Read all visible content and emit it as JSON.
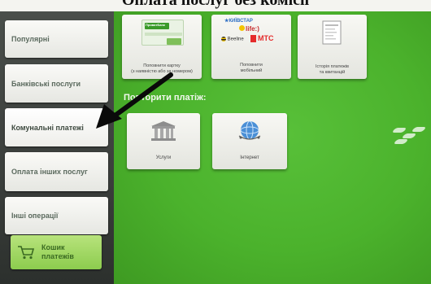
{
  "header": {
    "cropped_title": "Оплата послуг без комісії"
  },
  "sidebar": {
    "items": [
      {
        "label": "Популярні"
      },
      {
        "label": "Банківські послуги"
      },
      {
        "label": "Комунальні платежі"
      },
      {
        "label": "Оплата інших послуг"
      },
      {
        "label": "Інші операції"
      }
    ],
    "cart": {
      "label_line1": "Кошик",
      "label_line2": "платежів"
    }
  },
  "tiles": {
    "topup_card": {
      "line1": "Поповнити картку",
      "line2": "(з наявністю або за номером)",
      "card_brand": "ПриватБанк"
    },
    "topup_mobile": {
      "line1": "Поповнити",
      "line2": "мобільний",
      "brands": [
        "КИЇВСТАР",
        "life:)",
        "Beeline",
        "МТС"
      ]
    },
    "history": {
      "line1": "Історія платежів",
      "line2": "та квитанцій"
    }
  },
  "repeat_section": {
    "title": "Повторити платіж:",
    "tiles": [
      {
        "label": "Услуги",
        "icon": "bank-building-icon"
      },
      {
        "label": "Інтернет",
        "icon": "globe-network-icon"
      }
    ]
  },
  "colors": {
    "screen_green": "#4bb22c",
    "menu_text": "#5b6a5e",
    "cart_green": "#9fd662",
    "privat_green": "#3a9a2a",
    "kyivstar_blue": "#2f6fc4",
    "life_yellow": "#f3c400",
    "mts_red": "#e52b2b"
  }
}
